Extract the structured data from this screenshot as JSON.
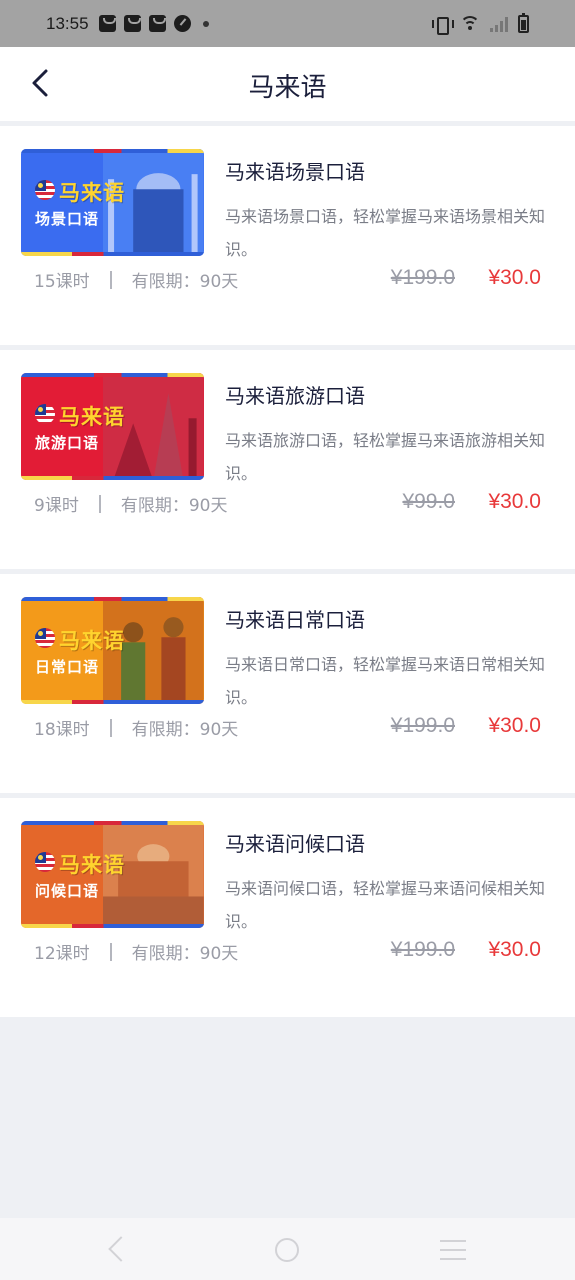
{
  "status_bar": {
    "time": "13:55",
    "notification_icons": [
      "shopping-bag-icon",
      "shopping-bag-icon",
      "shopping-bag-icon",
      "gauge-icon",
      "dot-icon"
    ],
    "system_icons": [
      "vibrate-icon",
      "wifi-icon",
      "signal-icon",
      "battery-icon"
    ]
  },
  "header": {
    "title": "马来语",
    "back_icon": "back-chevron-icon"
  },
  "courses": [
    {
      "thumb_lang": "马来语",
      "thumb_sub": "场景口语",
      "thumb_color": "#3a6cf0",
      "title": "马来语场景口语",
      "desc": "马来语场景口语，轻松掌握马来语场景相关知识。",
      "lessons": "15课时",
      "validity": "有限期：90天",
      "original_price": "¥199.0",
      "price": "¥30.0"
    },
    {
      "thumb_lang": "马来语",
      "thumb_sub": "旅游口语",
      "thumb_color": "#e21c36",
      "title": "马来语旅游口语",
      "desc": "马来语旅游口语，轻松掌握马来语旅游相关知识。",
      "lessons": "9课时",
      "validity": "有限期：90天",
      "original_price": "¥99.0",
      "price": "¥30.0"
    },
    {
      "thumb_lang": "马来语",
      "thumb_sub": "日常口语",
      "thumb_color": "#f39a1a",
      "title": "马来语日常口语",
      "desc": "马来语日常口语，轻松掌握马来语日常相关知识。",
      "lessons": "18课时",
      "validity": "有限期：90天",
      "original_price": "¥199.0",
      "price": "¥30.0"
    },
    {
      "thumb_lang": "马来语",
      "thumb_sub": "问候口语",
      "thumb_color": "#e4672a",
      "title": "马来语问候口语",
      "desc": "马来语问候口语，轻松掌握马来语问候相关知识。",
      "lessons": "12课时",
      "validity": "有限期：90天",
      "original_price": "¥199.0",
      "price": "¥30.0"
    }
  ],
  "nav_bar": {
    "icons": [
      "nav-back-icon",
      "nav-home-icon",
      "nav-menu-icon"
    ]
  },
  "colors": {
    "price_red": "#e8393a",
    "title_dark": "#1b1f3b",
    "muted_text": "#9a9ca6",
    "page_bg": "#eef0f4"
  }
}
